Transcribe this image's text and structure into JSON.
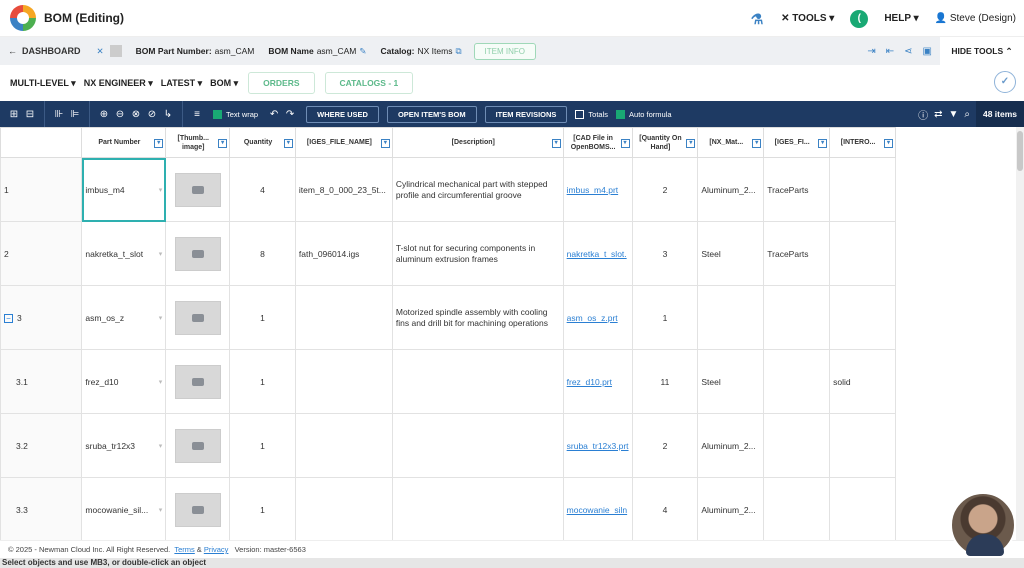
{
  "app": {
    "title": "BOM (Editing)"
  },
  "topbar": {
    "tools": "TOOLS",
    "help": "HELP",
    "user": "Steve (Design)"
  },
  "infobar": {
    "dashboard": "DASHBOARD",
    "bom_part_number_label": "BOM Part Number:",
    "bom_part_number": "asm_CAM",
    "bom_name_label": "BOM Name",
    "bom_name": "asm_CAM",
    "catalog_label": "Catalog:",
    "catalog": "NX Items",
    "item_info": "ITEM INFO",
    "hide_tools": "HIDE TOOLS"
  },
  "filters": {
    "multilevel": "MULTI-LEVEL",
    "engineer": "NX ENGINEER",
    "latest": "LATEST",
    "bom": "BOM",
    "orders": "ORDERS",
    "catalogs": "CATALOGS - 1"
  },
  "toolbar": {
    "text_wrap": "Text wrap",
    "where_used": "WHERE USED",
    "open_items_bom": "OPEN ITEM'S BOM",
    "item_revisions": "ITEM REVISIONS",
    "totals": "Totals",
    "auto_formula": "Auto formula",
    "items_count": "48 items"
  },
  "grid": {
    "headers": [
      "Part Number",
      "[Thumb... image]",
      "Quantity",
      "[IGES_FILE_NAME]",
      "[Description]",
      "[CAD File in OpenBOMS...",
      "[Quantity On Hand]",
      "[NX_Mat...",
      "[IGES_FI...",
      "[INTERO..."
    ],
    "rows": [
      {
        "num": "1",
        "part": "imbus_m4",
        "qty": "4",
        "iges": "item_8_0_000_23_5t...",
        "desc": "Cylindrical mechanical part with stepped profile and circumferential groove",
        "cad": "imbus_m4.prt",
        "onhand": "2",
        "mat": "Aluminum_2...",
        "igesfi": "TraceParts",
        "intero": ""
      },
      {
        "num": "2",
        "part": "nakretka_t_slot",
        "qty": "8",
        "iges": "fath_096014.igs",
        "desc": "T-slot nut for securing components in aluminum extrusion frames",
        "cad": "nakretka_t_slot.",
        "onhand": "3",
        "mat": "Steel",
        "igesfi": "TraceParts",
        "intero": ""
      },
      {
        "num": "3",
        "part": "asm_os_z",
        "qty": "1",
        "iges": "",
        "desc": "Motorized spindle assembly with cooling fins and drill bit for machining operations",
        "cad": "asm_os_z.prt",
        "onhand": "1",
        "mat": "",
        "igesfi": "",
        "intero": ""
      },
      {
        "num": "3.1",
        "part": "frez_d10",
        "qty": "1",
        "iges": "",
        "desc": "",
        "cad": "frez_d10.prt",
        "onhand": "11",
        "mat": "Steel",
        "igesfi": "",
        "intero": "solid"
      },
      {
        "num": "3.2",
        "part": "sruba_tr12x3",
        "qty": "1",
        "iges": "",
        "desc": "",
        "cad": "sruba_tr12x3.prt",
        "onhand": "2",
        "mat": "Aluminum_2...",
        "igesfi": "",
        "intero": ""
      },
      {
        "num": "3.3",
        "part": "mocowanie_sil...",
        "qty": "1",
        "iges": "",
        "desc": "",
        "cad": "mocowanie_siln",
        "onhand": "4",
        "mat": "Aluminum_2...",
        "igesfi": "",
        "intero": ""
      }
    ]
  },
  "footer": {
    "copyright": "© 2025 - Newman Cloud Inc. All Right Reserved.",
    "terms": "Terms",
    "amp": "&",
    "privacy": "Privacy",
    "version": "Version: master-6563"
  },
  "status": {
    "hint": "Select objects and use MB3, or double-click an object"
  }
}
